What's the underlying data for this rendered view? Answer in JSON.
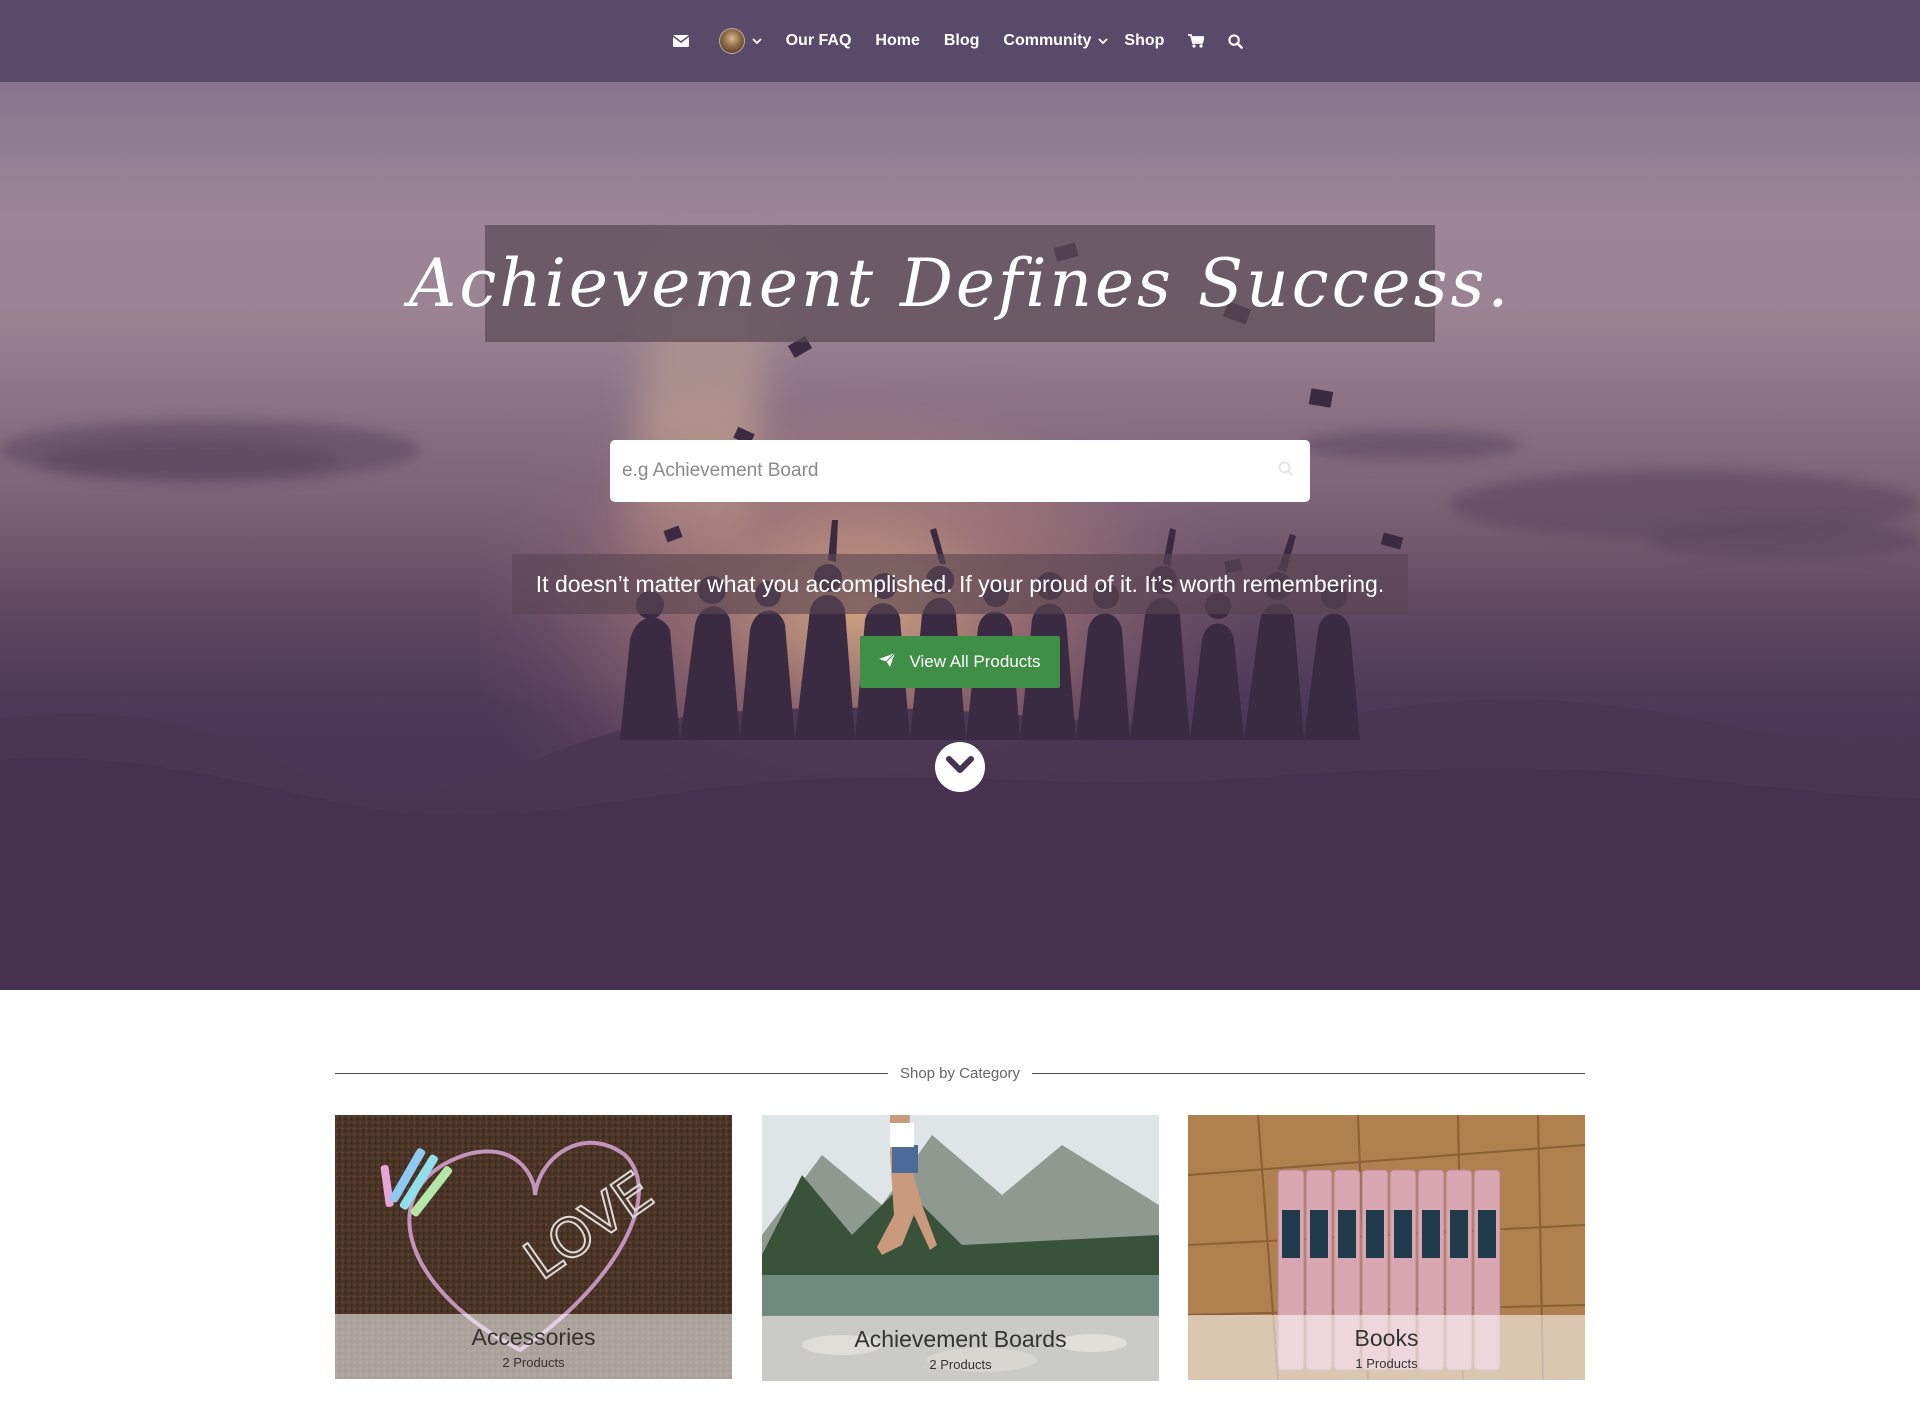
{
  "nav": {
    "items": [
      {
        "label": "Our FAQ"
      },
      {
        "label": "Home"
      },
      {
        "label": "Blog"
      },
      {
        "label": "Community"
      },
      {
        "label": "Shop"
      }
    ],
    "icons": [
      "mail-icon",
      "avatar",
      "chevron-down-icon",
      "cart-icon",
      "search-icon"
    ]
  },
  "hero": {
    "title": "Achievement Defines Success.",
    "search_placeholder": "e.g Achievement Board",
    "tagline": "It doesn’t matter what you accomplished. If your proud of it. It’s worth remembering.",
    "cta_label": "View All Products",
    "cta_icon": "paper-plane-icon",
    "scroll_icon": "chevron-down-circle-icon"
  },
  "categories": {
    "heading": "Shop by Category",
    "items": [
      {
        "title": "Accessories",
        "count": "2 Products"
      },
      {
        "title": "Achievement Boards",
        "count": "2 Products"
      },
      {
        "title": "Books",
        "count": "1 Products"
      }
    ]
  },
  "colors": {
    "nav_bg": "#5a4a6a",
    "cta_green": "#3f8f46",
    "hero_overlay": "#463452"
  }
}
